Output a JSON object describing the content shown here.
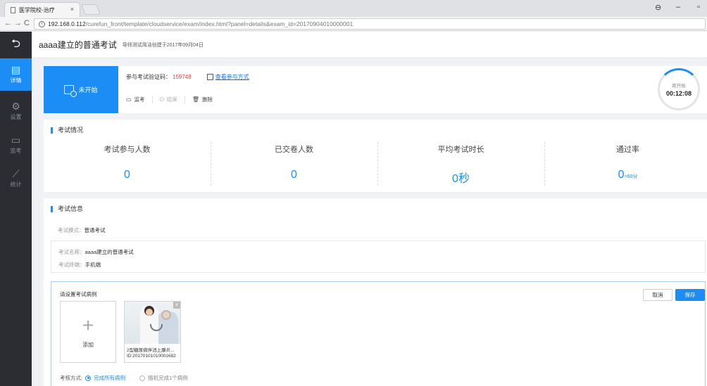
{
  "browser": {
    "tab_title": "医学院校-治疗",
    "tab_close": "×",
    "url_host": "192.168.0.112",
    "url_path": "/curefun_front/template/cloudservice/exam/index.html?panel=details&exam_id=20170904010000001"
  },
  "sidebar": {
    "back_label": "",
    "items": [
      {
        "label": "详情",
        "icon": "detail-icon",
        "active": true
      },
      {
        "label": "设置",
        "icon": "gear-icon",
        "active": false
      },
      {
        "label": "监考",
        "icon": "monitor-icon",
        "active": false
      },
      {
        "label": "统计",
        "icon": "chart-icon",
        "active": false
      }
    ]
  },
  "header": {
    "title": "aaaa建立的普通考试",
    "subtitle": "导师测试简洁创建于2017年09月04日"
  },
  "status": {
    "state_label": "未开始",
    "code_label": "参与考试验证码：",
    "code_value": "159748",
    "join_link": "查看参与方式",
    "actions": [
      {
        "label": "监考",
        "icon": "monitor-icon",
        "enabled": true
      },
      {
        "label": "结束",
        "icon": "power-icon",
        "enabled": false
      },
      {
        "label": "删除",
        "icon": "trash-icon",
        "enabled": true
      }
    ],
    "timer_label": "距开始",
    "timer_value": "00:12:08"
  },
  "stats": {
    "section_title": "考试情况",
    "items": [
      {
        "label": "考试参与人数",
        "value": "0",
        "suffix": ""
      },
      {
        "label": "已交卷人数",
        "value": "0",
        "suffix": ""
      },
      {
        "label": "平均考试时长",
        "value": "0秒",
        "suffix": ""
      },
      {
        "label": "通过率",
        "value": "0",
        "suffix": ">60分"
      }
    ]
  },
  "info": {
    "section_title": "考试信息",
    "mode_label": "考试模式：",
    "mode_value": "普通考试",
    "name_label": "考试名称：",
    "name_value": "aaaa建立的普通考试",
    "terminal_label": "考试终端：",
    "terminal_value": "手机端"
  },
  "cases": {
    "title": "请设置考试病例",
    "cancel_label": "取消",
    "save_label": "保存",
    "add_label": "添加",
    "items": [
      {
        "name": "2型糖尿病伴消上腺炎...",
        "id": "ID:20170101010001682"
      }
    ],
    "exam_mode_label": "考核方式:",
    "options": [
      {
        "label": "完成所有病例",
        "selected": true
      },
      {
        "label": "随机完成1个病例",
        "selected": false
      }
    ]
  },
  "colors": {
    "accent": "#1b8df5",
    "sidebar_bg": "#2b2d33",
    "code_red": "#e2483d"
  }
}
